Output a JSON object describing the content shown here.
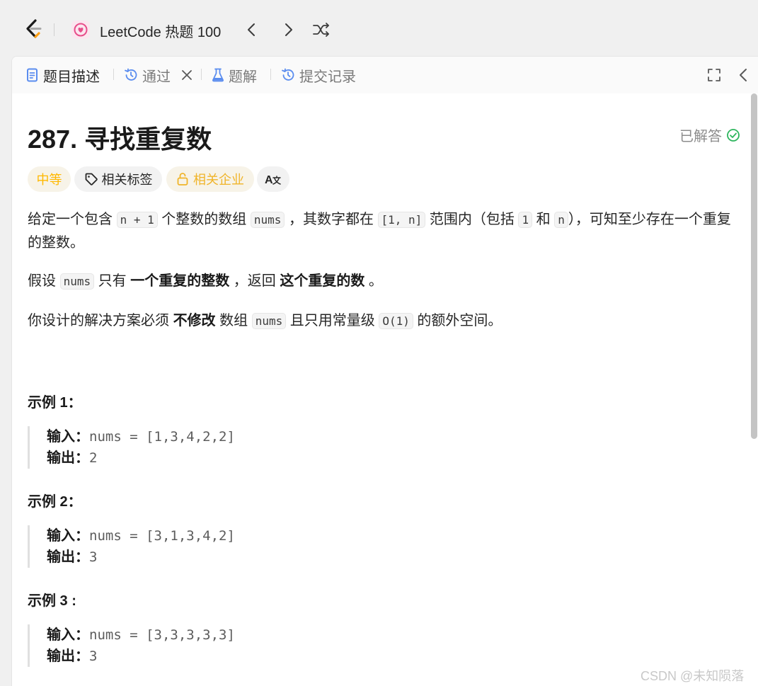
{
  "topbar": {
    "logo_icon": "leetcode-logo-icon",
    "list_icon": "heart-list-icon",
    "list_title": "LeetCode 热题 100",
    "prev_icon": "chevron-left-icon",
    "next_icon": "chevron-right-icon",
    "random_icon": "shuffle-icon"
  },
  "tabs": [
    {
      "label": "题目描述",
      "icon": "document-icon",
      "active": true
    },
    {
      "label": "通过",
      "icon": "history-icon",
      "active": false,
      "closable": true
    },
    {
      "label": "题解",
      "icon": "flask-icon",
      "active": false
    },
    {
      "label": "提交记录",
      "icon": "history-icon",
      "active": false
    }
  ],
  "problem": {
    "title": "287. 寻找重复数",
    "status": "已解答",
    "difficulty": "中等",
    "topics_label": "相关标签",
    "companies_label": "相关企业",
    "translate_label": "A文"
  },
  "description": {
    "p1": {
      "t1": "给定一个包含 ",
      "c1": "n + 1",
      "t2": " 个整数的数组 ",
      "c2": "nums",
      "t3": " ，其数字都在 ",
      "c3": "[1, n]",
      "t4": " 范围内（包括 ",
      "c4": "1",
      "t5": " 和 ",
      "c5": "n",
      "t6": "），可知至少存在一个重复的整数。"
    },
    "p2": {
      "t1": "假设 ",
      "c1": "nums",
      "t2": " 只有 ",
      "b1": "一个重复的整数",
      "t3": " ，返回 ",
      "b2": "这个重复的数",
      "t4": " 。"
    },
    "p3": {
      "t1": "你设计的解决方案必须 ",
      "b1": "不修改",
      "t2": " 数组 ",
      "c1": "nums",
      "t3": " 且只用常量级 ",
      "c2": "O(1)",
      "t4": " 的额外空间。"
    }
  },
  "examples": [
    {
      "title": "示例 1：",
      "input_label": "输入：",
      "input": "nums = [1,3,4,2,2]",
      "output_label": "输出：",
      "output": "2"
    },
    {
      "title": "示例 2：",
      "input_label": "输入：",
      "input": "nums = [3,1,3,4,2]",
      "output_label": "输出：",
      "output": "3"
    },
    {
      "title": "示例 3 :",
      "input_label": "输入：",
      "input": "nums = [3,3,3,3,3]",
      "output_label": "输出：",
      "output": "3"
    }
  ],
  "watermark": "CSDN @未知陨落",
  "colors": {
    "difficulty_medium": "#ffb800",
    "solved_green": "#2db55d",
    "tab_icon_blue": "#5b8def",
    "list_icon_pink": "#e84d8a"
  }
}
